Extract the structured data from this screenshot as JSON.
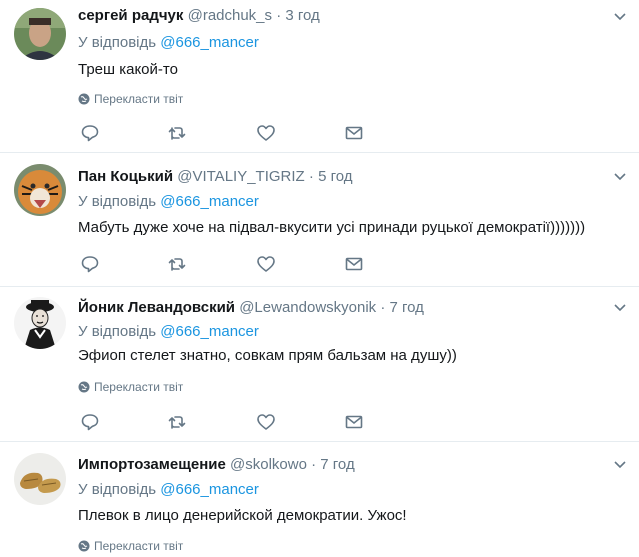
{
  "tweets": [
    {
      "name": "сергей радчук",
      "handle": "@radchuk_s",
      "sep": "·",
      "time": "3 год",
      "reply_prefix": "У відповідь",
      "reply_to": "@666_mancer",
      "text": "Треш какой-то",
      "translate": "Перекласти твіт"
    },
    {
      "name": "Пан Коцький",
      "handle": "@VITALIY_TIGRIZ",
      "sep": "·",
      "time": "5 год",
      "reply_prefix": "У відповідь",
      "reply_to": "@666_mancer",
      "text": "Мабуть дуже хоче на підвал-вкусити усі принади руцької демократії)))))))",
      "translate": ""
    },
    {
      "name": "Йоник Левандовский",
      "handle": "@Lewandowskyonik",
      "sep": "·",
      "time": "7 год",
      "reply_prefix": "У відповідь",
      "reply_to": "@666_mancer",
      "text": "Эфиоп стелет знатно, совкам прям бальзам на душу))",
      "translate": "Перекласти твіт"
    },
    {
      "name": "Импортозамещение",
      "handle": "@skolkowo",
      "sep": "·",
      "time": "7 год",
      "reply_prefix": "У відповідь",
      "reply_to": "@666_mancer",
      "text": "Плевок в лицо денерийской демократии. Ужос!",
      "translate": "Перекласти твіт"
    }
  ],
  "colors": {
    "icon": "#657786",
    "mention": "#1b95e0",
    "divider": "#e6ecf0"
  },
  "icons": [
    "reply-icon",
    "retweet-icon",
    "like-icon",
    "message-icon",
    "globe-icon",
    "chevron-down-icon"
  ]
}
